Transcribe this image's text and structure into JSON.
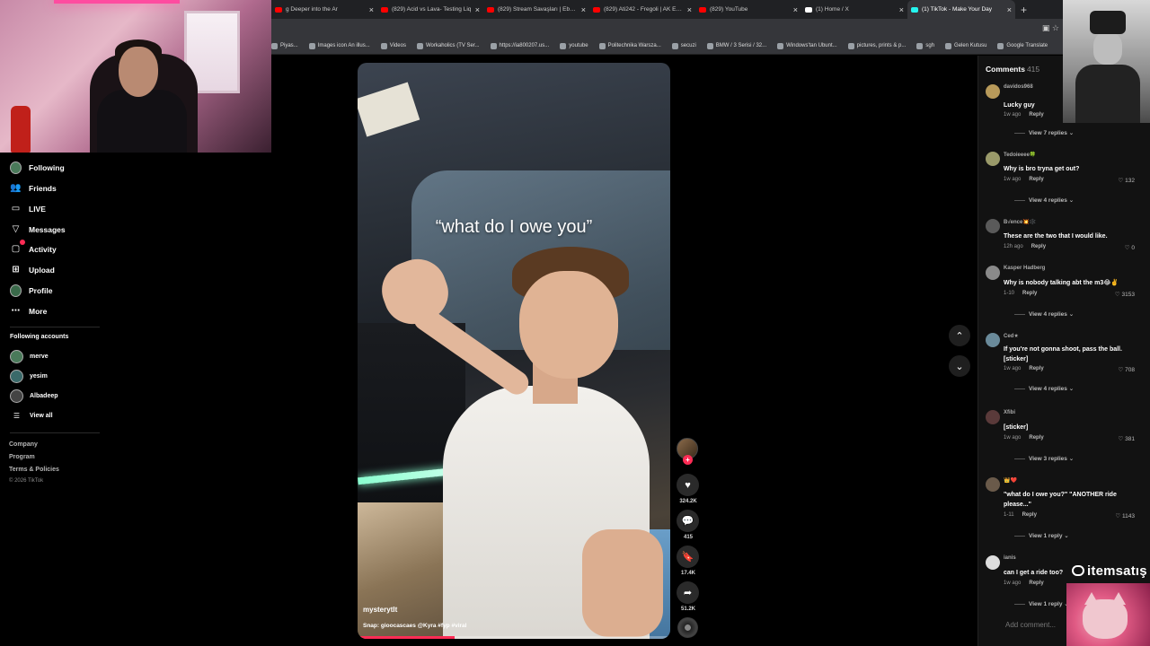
{
  "browser": {
    "tabs": [
      {
        "title": "g Deeper into the Ar",
        "fav": "#ff0000"
      },
      {
        "title": "(829) Acid vs Lava- Testing Liq",
        "fav": "#ff0000"
      },
      {
        "title": "(829) Stream Savaşları | Ebo x U",
        "fav": "#ff0000"
      },
      {
        "title": "(829) Ati242 - Fregoli | AK Exclu",
        "fav": "#ff0000"
      },
      {
        "title": "(829) YouTube",
        "fav": "#ff0000"
      },
      {
        "title": "(1) Home / X",
        "fav": "#ffffff"
      },
      {
        "title": "(1) TikTok - Make Your Day",
        "fav": "#25f4ee",
        "active": true
      }
    ],
    "new_tab": "+",
    "bookmarks": [
      "Piyas...",
      "Images icon An illus...",
      "Videos",
      "Workaholics (TV Ser...",
      "https://ia800207.us...",
      "youtube",
      "Politechnika Warsza...",
      "secuzi",
      "BMW / 3 Serisi / 32...",
      "Windows'tan Ubunt...",
      "pictures, prints & p...",
      "sgh",
      "Gelen Kutusu",
      "Google Translate"
    ]
  },
  "nav": {
    "items": [
      {
        "label": "Following",
        "icon": "following-avatar-icon"
      },
      {
        "label": "Friends",
        "icon": "friends-icon"
      },
      {
        "label": "LIVE",
        "icon": "live-icon"
      },
      {
        "label": "Messages",
        "icon": "messages-icon"
      },
      {
        "label": "Activity",
        "icon": "activity-icon"
      },
      {
        "label": "Upload",
        "icon": "upload-icon"
      },
      {
        "label": "Profile",
        "icon": "profile-icon"
      },
      {
        "label": "More",
        "icon": "more-icon"
      }
    ],
    "following_title": "Following accounts",
    "accounts": [
      "merve",
      "yesim",
      "Albadeep"
    ],
    "view_all": "View all",
    "footer": [
      "Company",
      "Program",
      "Terms & Policies"
    ],
    "copyright": "© 2026 TikTok"
  },
  "video": {
    "caption": "“what do I owe you”",
    "author": "mysterytlt",
    "description": "Snap: gioocascaes @Kyra #fyp #viral",
    "progress": 0.31
  },
  "actions": {
    "likes": "324.2K",
    "comments": "415",
    "saves": "17.4K",
    "shares": "51.2K"
  },
  "comments": {
    "title": "Comments",
    "count": "415",
    "add_placeholder": "Add comment...",
    "items": [
      {
        "user": "davidos968",
        "text": "Lucky guy",
        "time": "1w ago",
        "likes": "",
        "replies": "View 7 replies",
        "avatar": "#b89a5a"
      },
      {
        "user": "Tedoieeee🍀",
        "text": "Why is bro tryna get out?",
        "time": "1w ago",
        "likes": "132",
        "replies": "View 4 replies",
        "avatar": "#9a9a6a"
      },
      {
        "user": "B√ence💥🕸️",
        "text": "These are the two that I would like.",
        "time": "12h ago",
        "likes": "0",
        "replies": "",
        "avatar": "#5a5a5a"
      },
      {
        "user": "Kasper Hadberg",
        "text": "Why is nobody talking abt the m3😂✌️",
        "time": "1-10",
        "likes": "3153",
        "replies": "View 4 replies",
        "avatar": "#8a8a8a"
      },
      {
        "user": "Ced★",
        "text": "If you're not gonna shoot, pass the ball. [sticker]",
        "time": "1w ago",
        "likes": "708",
        "replies": "View 4 replies",
        "avatar": "#6a8a9a"
      },
      {
        "user": "Xfibi",
        "text": "[sticker]",
        "time": "1w ago",
        "likes": "381",
        "replies": "View 3 replies",
        "avatar": "#5a3a3a"
      },
      {
        "user": "👑❤️",
        "text": "\"what do I owe you?\" \"ANOTHER ride please...\"",
        "time": "1-11",
        "likes": "1143",
        "replies": "View 1 reply",
        "avatar": "#6a5a4a"
      },
      {
        "user": "ianis",
        "text": "can I get a ride too?",
        "time": "1w ago",
        "likes": "",
        "replies": "View 1 reply",
        "avatar": "#dddddd"
      }
    ],
    "reply_label": "Reply"
  },
  "watermark": "itemsatış",
  "colors": {
    "accent": "#fe2c55",
    "background": "#000000",
    "panel": "#121212"
  }
}
